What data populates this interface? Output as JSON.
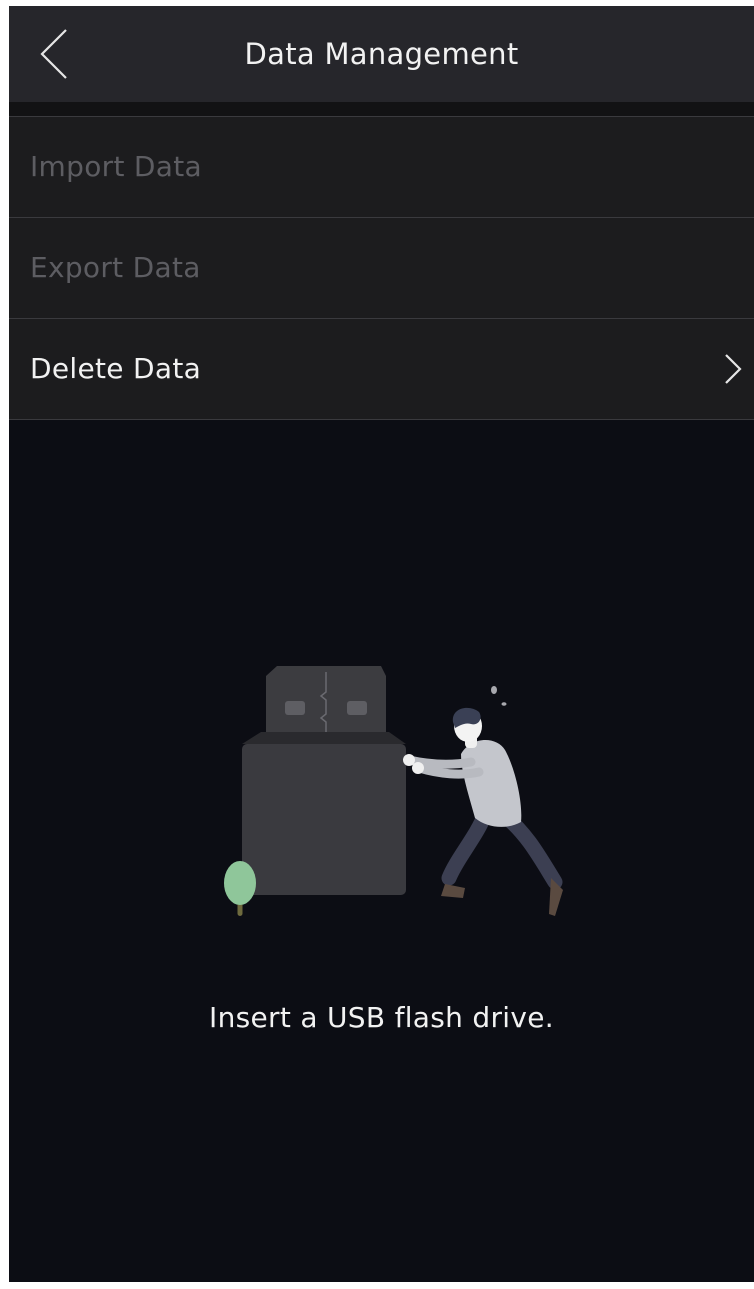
{
  "header": {
    "title": "Data Management",
    "back_icon": "chevron-left-icon"
  },
  "menu": {
    "items": [
      {
        "label": "Import Data",
        "enabled": false
      },
      {
        "label": "Export Data",
        "enabled": false
      },
      {
        "label": "Delete Data",
        "enabled": true,
        "icon": "chevron-right-icon"
      }
    ]
  },
  "empty_state": {
    "illustration": "usb-drive-person-pushing-illustration",
    "message": "Insert a USB flash drive."
  },
  "colors": {
    "background": "#0c0d14",
    "header": "#26262b",
    "row": "#1c1c1e",
    "text": "#f2f2f2",
    "text_disabled": "#5d5d62",
    "tree_leaf": "#8fc69a"
  }
}
